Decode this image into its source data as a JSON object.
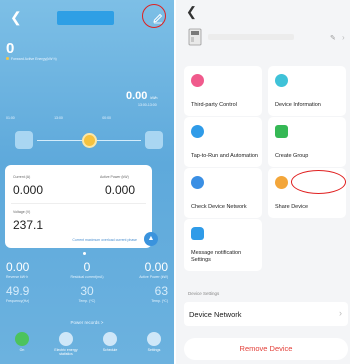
{
  "left_panel": {
    "energy_total": "0",
    "energy_subtitle": "Forward Active Energy(kW·h)",
    "daily_energy": {
      "value": "0.00",
      "unit": "kWh",
      "time": "13:00-13:00"
    },
    "time_axis": [
      "01:00",
      "13:00",
      "00:00"
    ],
    "card": {
      "current_label": "Current (A)",
      "current_value": "0.000",
      "power_label": "Active Power (kW)",
      "power_value": "0.000",
      "voltage_label": "Voltage (V)",
      "voltage_value": "237.1",
      "hint": "Current maximum overload current phase"
    },
    "stats_row1": [
      {
        "value": "0.00",
        "caption": "Reverse kW·h"
      },
      {
        "value": "0",
        "caption": "Residual current(mA)"
      },
      {
        "value": "0.00",
        "caption": "Active Power (kW)"
      }
    ],
    "stats_row2": [
      {
        "value": "49.9",
        "caption": "Frequency(Hz)"
      },
      {
        "value": "30",
        "caption": "Temp. (ºC)"
      },
      {
        "value": "63",
        "caption": "Temp. (ºC)"
      }
    ],
    "power_records": "Power records >",
    "nav": [
      {
        "label": "On",
        "icon": "power-icon"
      },
      {
        "label": "Electric energy statistics",
        "icon": "chart-icon"
      },
      {
        "label": "Schedule",
        "icon": "clock-icon"
      },
      {
        "label": "Settings",
        "icon": "gear-icon"
      }
    ]
  },
  "right_panel": {
    "tiles": [
      {
        "label": "Third-party Control",
        "icon": "third-party-icon"
      },
      {
        "label": "Device Information",
        "icon": "info-icon"
      },
      {
        "label": "Tap-to-Run and Automation",
        "icon": "automation-icon"
      },
      {
        "label": "Create Group",
        "icon": "group-icon"
      },
      {
        "label": "Check Device Network",
        "icon": "network-icon"
      },
      {
        "label": "Share Device",
        "icon": "share-icon"
      },
      {
        "label": "Message notification Settings",
        "icon": "bell-icon"
      }
    ],
    "section_label": "Device Settings",
    "device_network": "Device Network",
    "remove_label": "Remove Device"
  },
  "colors": {
    "left_gradient_top": "#7dbfe6",
    "left_gradient_bottom": "#6cb2df",
    "annotation_red": "#e02020",
    "remove_red": "#e3403a",
    "share_orange": "#f3a63a"
  }
}
